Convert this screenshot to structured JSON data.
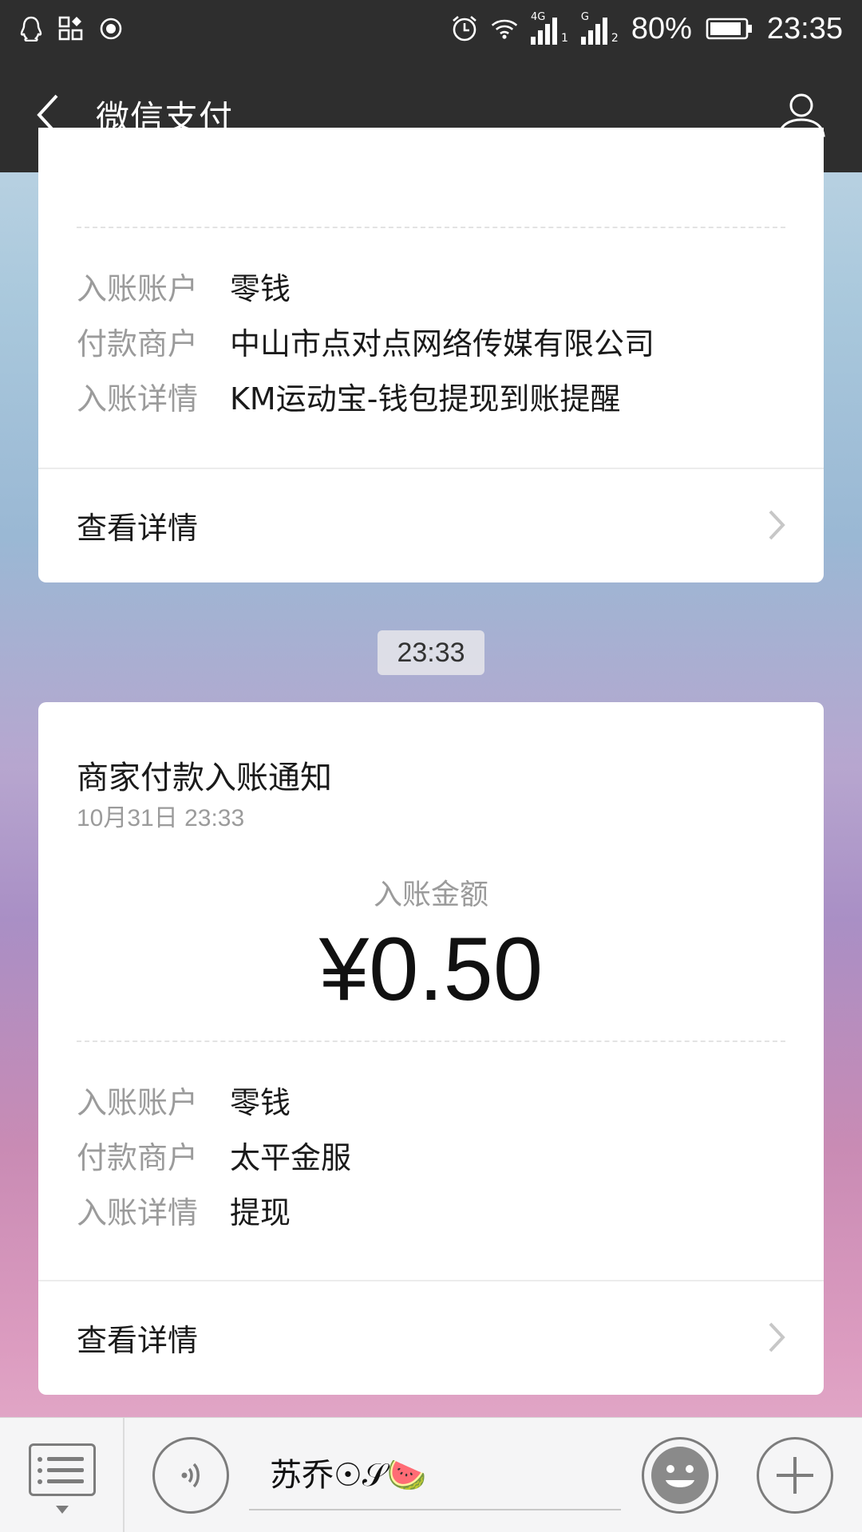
{
  "status_bar": {
    "battery": "80%",
    "time": "23:35",
    "network_4g": "4G",
    "network_g": "G",
    "icons": [
      "qq-icon",
      "apps-icon",
      "record-icon",
      "alarm-icon",
      "wifi-icon",
      "signal-4g-icon",
      "signal-g-icon",
      "battery-icon"
    ]
  },
  "header": {
    "title": "微信支付",
    "back_icon": "back-arrow-icon",
    "profile_icon": "profile-icon"
  },
  "messages": [
    {
      "rows": [
        {
          "label": "入账账户",
          "value": "零钱"
        },
        {
          "label": "付款商户",
          "value": "中山市点对点网络传媒有限公司"
        },
        {
          "label": "入账详情",
          "value": "KM运动宝-钱包提现到账提醒"
        }
      ],
      "detail_link": "查看详情"
    },
    {
      "timestamp_chip": "23:33",
      "title": "商家付款入账通知",
      "time": "10月31日  23:33",
      "amount_label": "入账金额",
      "amount": "¥0.50",
      "rows": [
        {
          "label": "入账账户",
          "value": "零钱"
        },
        {
          "label": "付款商户",
          "value": "太平金服"
        },
        {
          "label": "入账详情",
          "value": "提现"
        }
      ],
      "detail_link": "查看详情"
    }
  ],
  "bottom_bar": {
    "input_text": "苏乔☉𝒮🍉",
    "icons": [
      "menu-icon",
      "voice-icon",
      "emoji-icon",
      "plus-icon"
    ]
  }
}
